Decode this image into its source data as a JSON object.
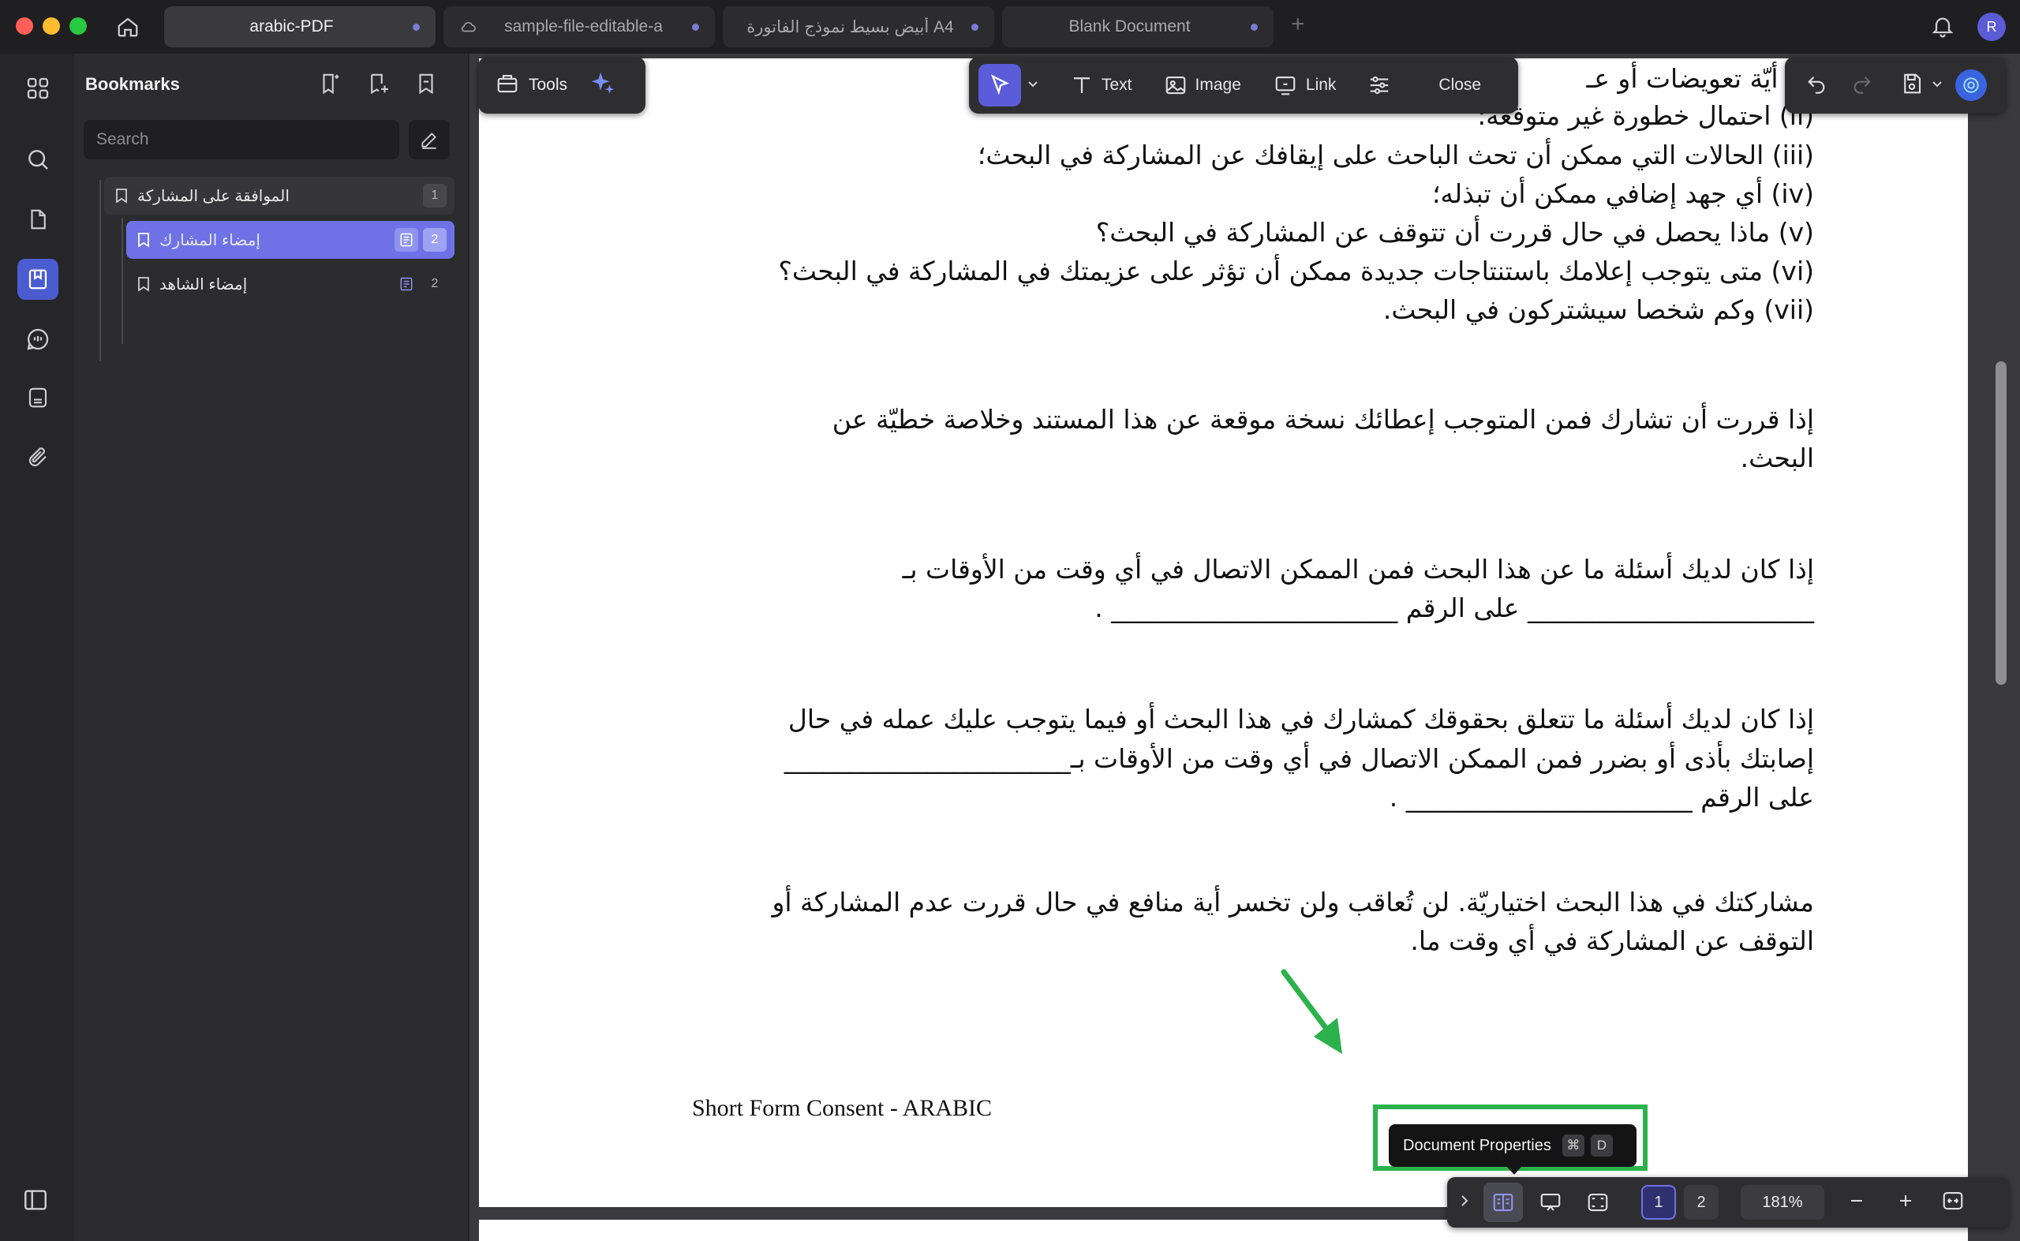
{
  "tabs": [
    {
      "title": "arabic-PDF",
      "active": true
    },
    {
      "title": "sample-file-editable-a",
      "active": false,
      "cloud": true
    },
    {
      "title": "A4 أبيض بسيط نموذج الفاتورة",
      "active": false
    },
    {
      "title": "Blank Document",
      "active": false
    }
  ],
  "user": {
    "avatar_letter": "R"
  },
  "panel": {
    "title": "Bookmarks",
    "search_placeholder": "Search",
    "bookmarks": [
      {
        "label": "الموافقة على المشاركة",
        "page": "1"
      },
      {
        "label": "إمضاء المشارك",
        "page": "2"
      },
      {
        "label": "إمضاء الشاهد",
        "page": "2"
      }
    ]
  },
  "toolbar": {
    "tools_label": "Tools",
    "text_label": "Text",
    "image_label": "Image",
    "link_label": "Link",
    "close_label": "Close"
  },
  "document": {
    "list": [
      "(i) أيّة تعويضات أو عـ",
      "(ii) احتمال خطورة غير متوقعة؛",
      "(iii) الحالات التي ممكن أن تحث الباحث على إيقافك عن المشاركة في البحث؛",
      "(iv) أي جهد إضافي ممكن أن تبذله؛",
      "(v) ماذا يحصل في حال قررت أن تتوقف عن المشاركة في البحث؟",
      "(vi) متى يتوجب إعلامك باستنتاجات جديدة ممكن أن تؤثر على عزيمتك في المشاركة في البحث؟",
      "(vii) وكم شخصا سيشتركون في البحث."
    ],
    "para1": [
      "إذا قررت أن تشارك فمن المتوجب إعطائك نسخة موقعة عن هذا المستند وخلاصة خطيّة عن",
      "البحث."
    ],
    "para2": [
      "إذا كان لديك أسئلة ما عن هذا البحث فمن الممكن الاتصال في أي وقت من الأوقات بـ",
      "______________________ على الرقم ______________________ ."
    ],
    "para3": [
      "إذا كان لديك أسئلة ما تتعلق بحقوقك كمشارك في هذا البحث أو فيما يتوجب عليك عمله في حال",
      "إصابتك بأذى أو بضرر فمن الممكن الاتصال في أي وقت من الأوقات بـ______________________",
      "على الرقم ______________________ ."
    ],
    "para4": [
      "مشاركتك في هذا البحث اختياريّة. لن تُعاقب ولن تخسر أية منافع في حال قررت عدم المشاركة أو",
      "التوقف عن المشاركة في أي وقت ما."
    ],
    "footer": "Short Form Consent - ARABIC"
  },
  "tooltip": {
    "label": "Document Properties",
    "key1": "⌘",
    "key2": "D"
  },
  "status": {
    "pages": [
      "1",
      "2"
    ],
    "current_page": "1",
    "zoom": "181%"
  },
  "colors": {
    "accent": "#6e72e6",
    "annotation": "#2bb24c"
  }
}
